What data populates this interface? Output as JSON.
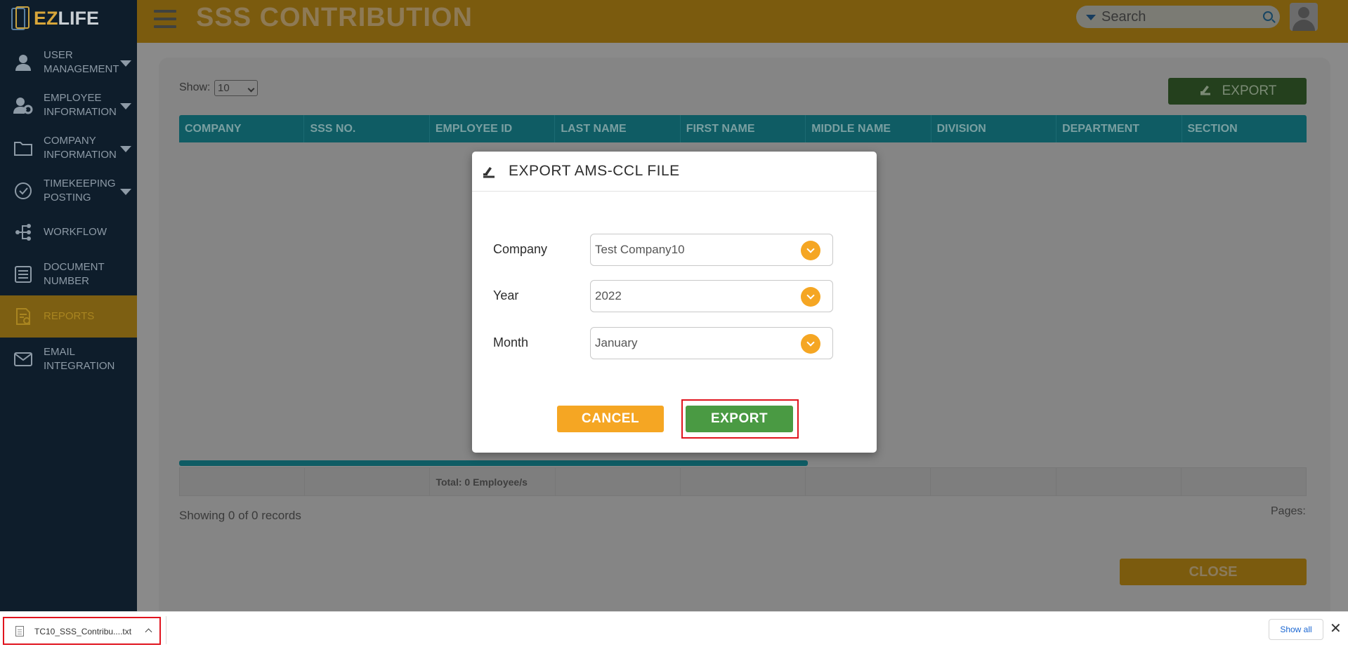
{
  "app": {
    "logo_ez": "EZ",
    "logo_life": "LIFE",
    "page_title": "SSS CONTRIBUTION",
    "search_placeholder": "Search"
  },
  "sidebar": {
    "items": [
      {
        "label": "USER MANAGEMENT",
        "icon": "user-icon",
        "has_caret": true
      },
      {
        "label": "EMPLOYEE INFORMATION",
        "icon": "employee-gear-icon",
        "has_caret": true
      },
      {
        "label": "COMPANY INFORMATION",
        "icon": "folder-icon",
        "has_caret": true
      },
      {
        "label": "TIMEKEEPING POSTING",
        "icon": "check-circle-icon",
        "has_caret": true
      },
      {
        "label": "WORKFLOW",
        "icon": "workflow-icon",
        "has_caret": false
      },
      {
        "label": "DOCUMENT NUMBER",
        "icon": "document-list-icon",
        "has_caret": false
      },
      {
        "label": "REPORTS",
        "icon": "report-icon",
        "has_caret": false,
        "active": true
      },
      {
        "label": "EMAIL INTEGRATION",
        "icon": "envelope-icon",
        "has_caret": false
      }
    ]
  },
  "main": {
    "show_label": "Show:",
    "show_value": "10",
    "export_label": "EXPORT",
    "columns": [
      "COMPANY",
      "SSS NO.",
      "EMPLOYEE ID",
      "LAST NAME",
      "FIRST NAME",
      "MIDDLE NAME",
      "DIVISION",
      "DEPARTMENT",
      "SECTION"
    ],
    "footer_total": "Total: 0 Employee/s",
    "showing_text": "Showing 0 of 0 records",
    "pages_label": "Pages:",
    "close_label": "CLOSE"
  },
  "modal": {
    "title": "EXPORT AMS-CCL FILE",
    "fields": {
      "company": {
        "label": "Company",
        "value": "Test Company10"
      },
      "year": {
        "label": "Year",
        "value": "2022"
      },
      "month": {
        "label": "Month",
        "value": "January"
      }
    },
    "cancel_label": "CANCEL",
    "export_label": "EXPORT"
  },
  "download_bar": {
    "file_name": "TC10_SSS_Contribu....txt",
    "show_all": "Show all",
    "close_glyph": "✕"
  },
  "colors": {
    "accent_orange": "#f5a623",
    "export_green": "#4a9a43",
    "table_header_teal": "#0f5c64",
    "highlight_red": "#e0141e"
  }
}
